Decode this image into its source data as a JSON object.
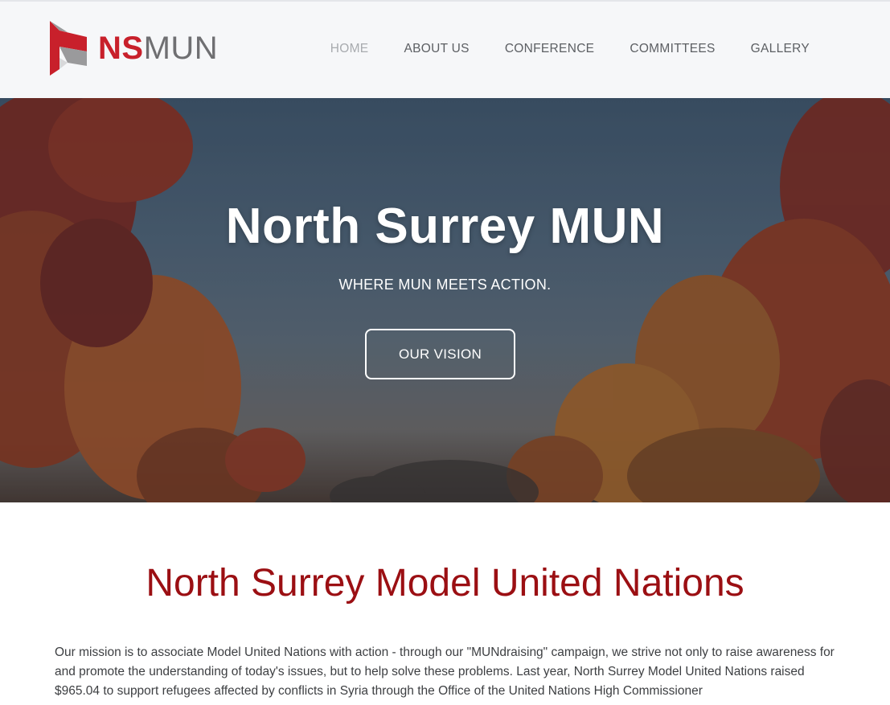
{
  "brand": {
    "logo_ns": "NS",
    "logo_mun": "MUN",
    "red": "#c8202b",
    "gray": "#6f6f72"
  },
  "nav": {
    "items": [
      {
        "label": "HOME",
        "active": true
      },
      {
        "label": "ABOUT US",
        "active": false
      },
      {
        "label": "CONFERENCE",
        "active": false
      },
      {
        "label": "COMMITTEES",
        "active": false
      },
      {
        "label": "GALLERY",
        "active": false
      }
    ]
  },
  "hero": {
    "title": "North Surrey MUN",
    "subtitle": "WHERE MUN MEETS ACTION.",
    "button_label": "OUR VISION"
  },
  "main": {
    "title": "North Surrey Model United Nations",
    "title_color": "#9b0f13",
    "mission": "Our mission is to associate Model United Nations with action - through our \"MUNdraising\" campaign, we strive not only to raise awareness for and promote the understanding of today's issues, but to help solve these problems. Last year, North Surrey Model United Nations raised $965.04 to support refugees affected by conflicts in Syria through the Office of the United Nations High Commissioner"
  }
}
